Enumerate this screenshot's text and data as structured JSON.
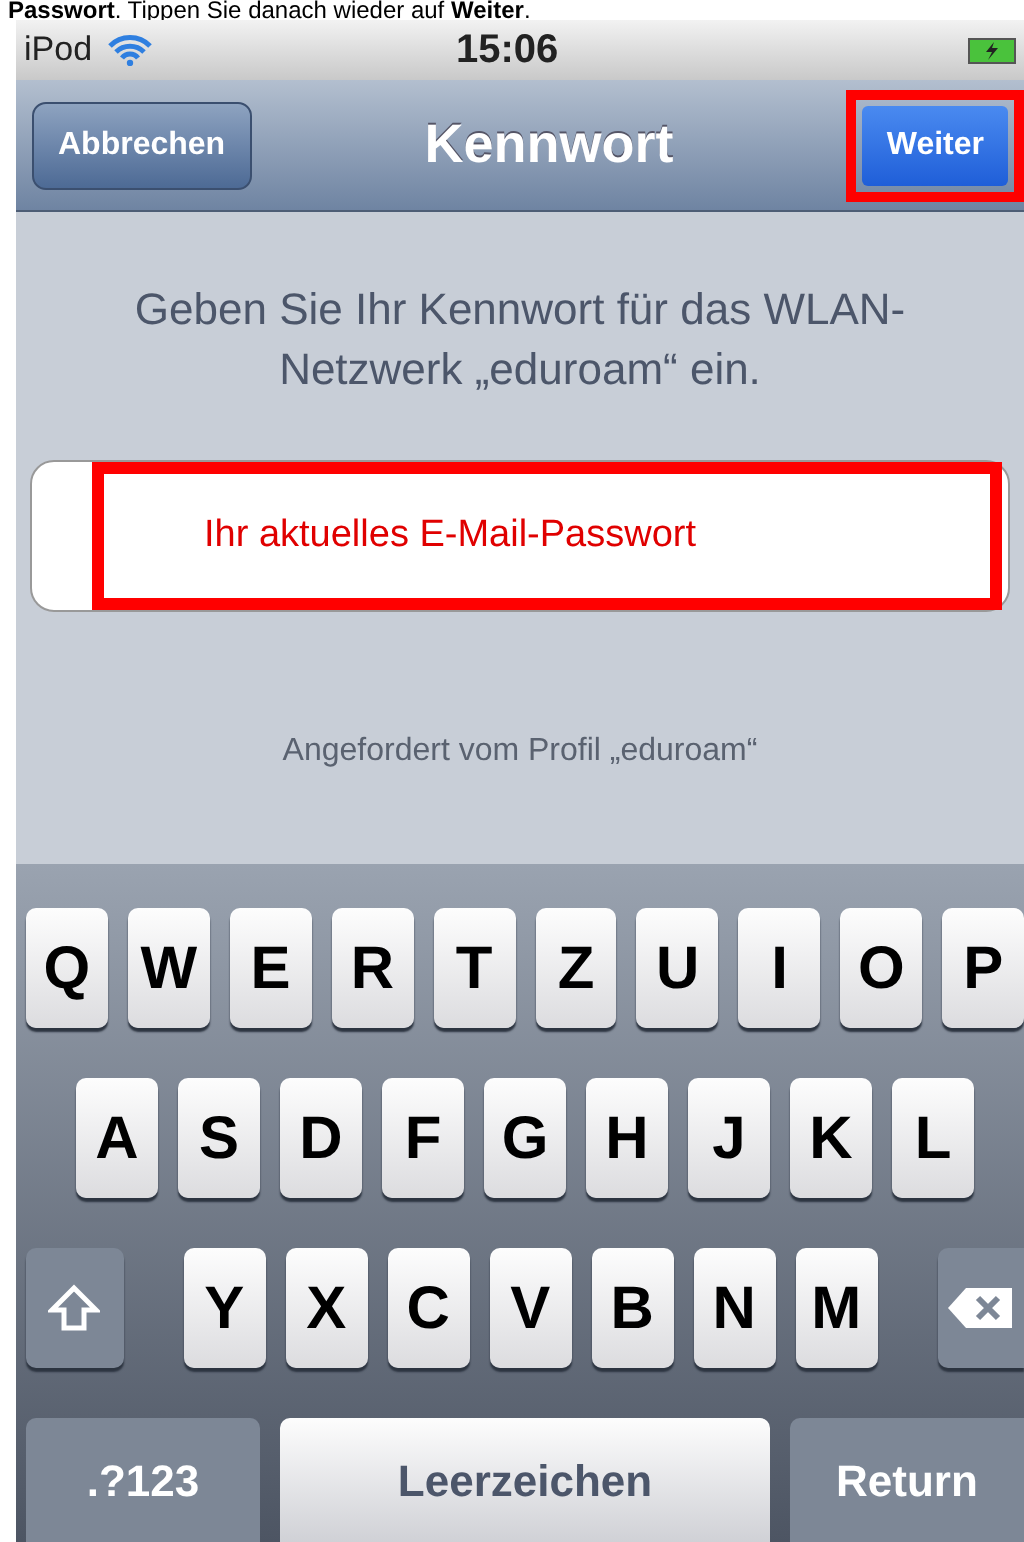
{
  "caption": "**Passwort**. Tippen Sie danach wieder auf **Weiter**.",
  "status_bar": {
    "device": "iPod",
    "time": "15:06"
  },
  "nav_bar": {
    "title": "Kennwort",
    "cancel": "Abbrechen",
    "next": {
      "label": "Weiter",
      "highlighted": true
    }
  },
  "prompt": "Geben Sie Ihr Kennwort für das WLAN-Netzwerk „eduroam“ ein.",
  "password_field": {
    "value": "Ihr aktuelles E-Mail-Passwort",
    "highlighted": true
  },
  "footer": "Angefordert vom Profil „eduroam“",
  "keyboard": {
    "rows": [
      [
        "Q",
        "W",
        "E",
        "R",
        "T",
        "Z",
        "U",
        "I",
        "O",
        "P"
      ],
      [
        "A",
        "S",
        "D",
        "F",
        "G",
        "H",
        "J",
        "K",
        "L"
      ],
      [
        "Y",
        "X",
        "C",
        "V",
        "B",
        "N",
        "M"
      ]
    ],
    "numbers": ".?123",
    "space": "Leerzeichen",
    "return": "Return"
  }
}
